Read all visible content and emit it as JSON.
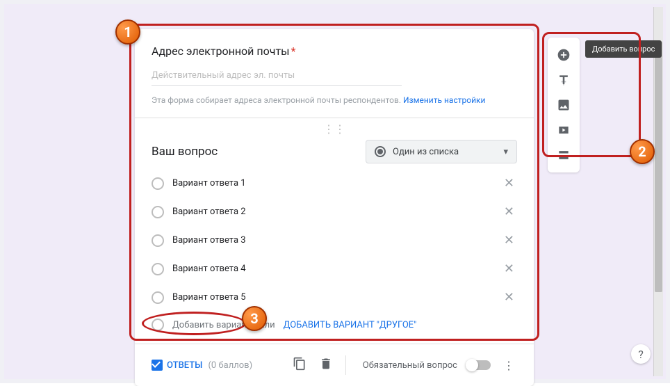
{
  "email": {
    "title": "Адрес электронной почты",
    "placeholder": "Действительный адрес эл. почты",
    "hint": "Эта форма собирает адреса электронной почты респондентов.",
    "settings_link": "Изменить настройки"
  },
  "question": {
    "title": "Ваш вопрос",
    "type_label": "Один из списка",
    "options": [
      "Вариант ответа 1",
      "Вариант ответа 2",
      "Вариант ответа 3",
      "Вариант ответа 4",
      "Вариант ответа 5"
    ],
    "add_option": "Добавить вариант",
    "or": "или",
    "add_other": "ДОБАВИТЬ ВАРИАНТ \"ДРУГОЕ\""
  },
  "footer": {
    "answers": "ОТВЕТЫ",
    "points": "(0 баллов)",
    "required": "Обязательный вопрос"
  },
  "tooltip": "Добавить вопрос",
  "badges": {
    "b1": "1",
    "b2": "2",
    "b3": "3"
  }
}
